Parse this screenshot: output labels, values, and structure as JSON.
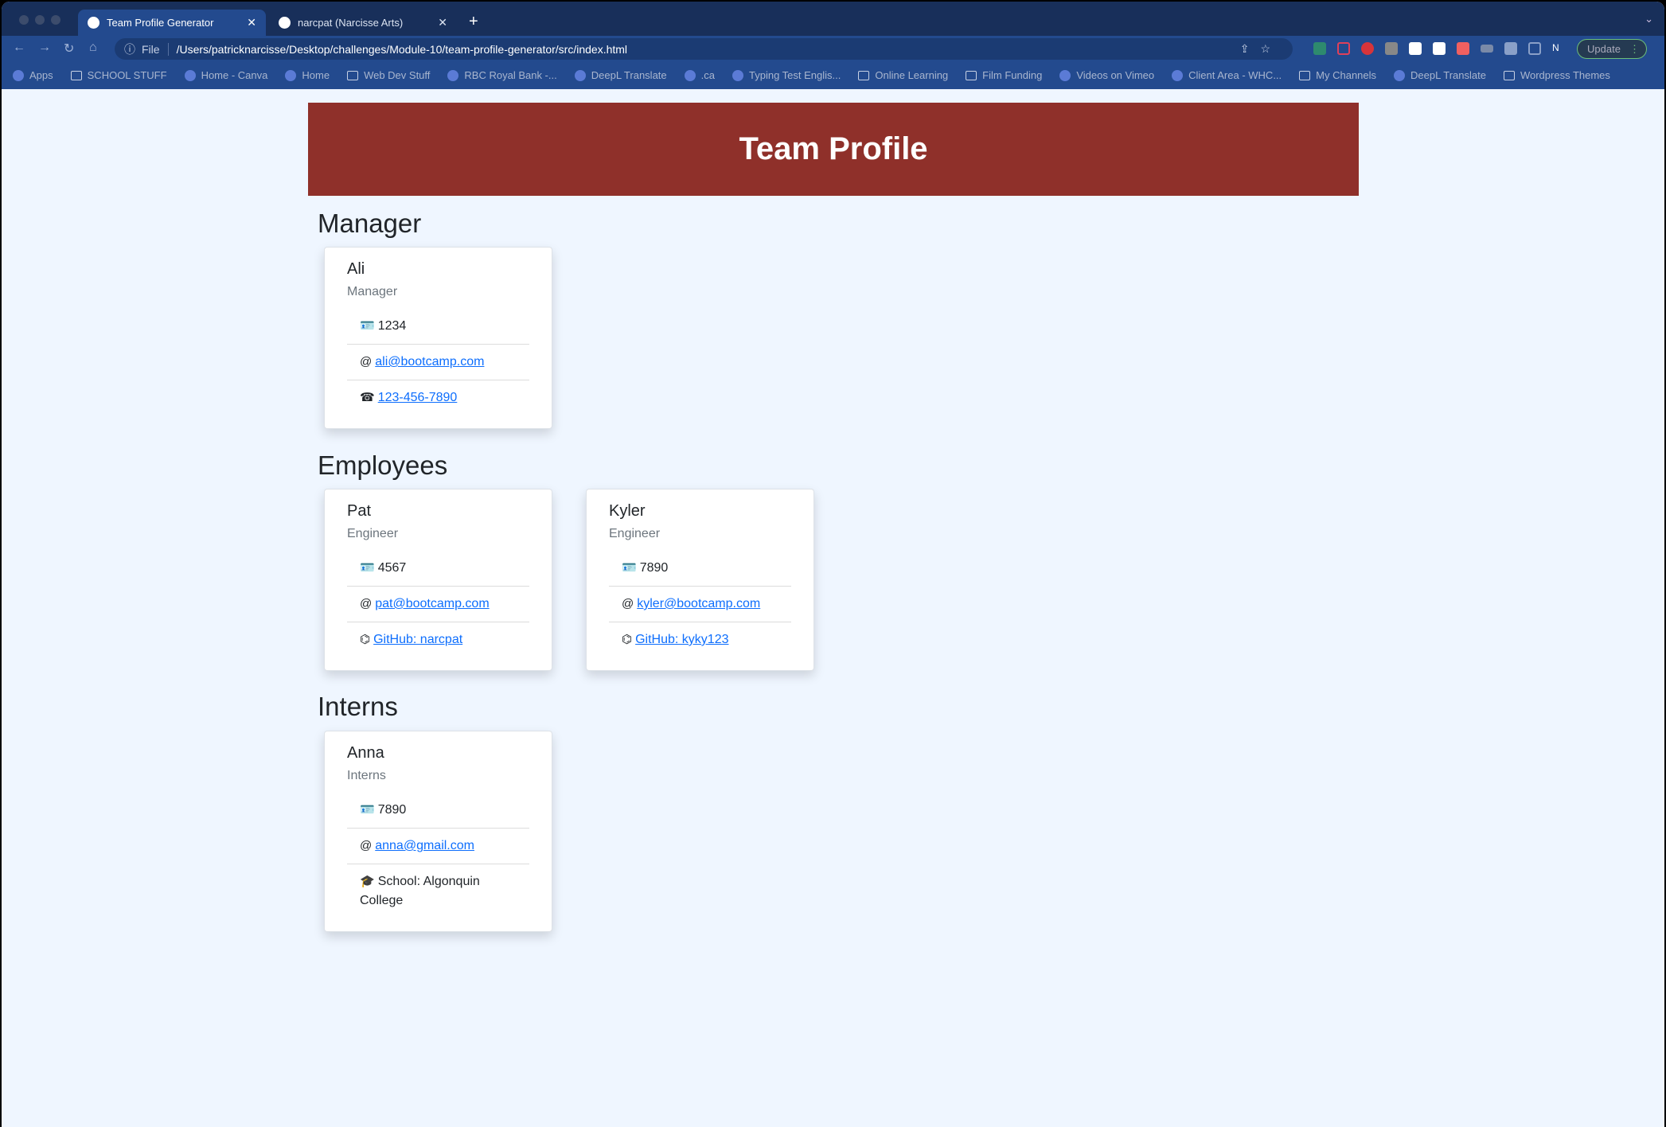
{
  "browser": {
    "tabs": [
      {
        "title": "Team Profile Generator",
        "active": true
      },
      {
        "title": "narcpat (Narcisse Arts)",
        "active": false
      }
    ],
    "address_scheme": "File",
    "url": "/Users/patricknarcisse/Desktop/challenges/Module-10/team-profile-generator/src/index.html",
    "update_label": "Update",
    "profile_initial": "N",
    "bookmarks": [
      "Apps",
      "SCHOOL STUFF",
      "Home - Canva",
      "Home",
      "Web Dev Stuff",
      "RBC Royal Bank -...",
      "DeepL Translate",
      ".ca",
      "Typing Test Englis...",
      "Online Learning",
      "Film Funding",
      "Videos on Vimeo",
      "Client Area - WHC...",
      "My Channels",
      "DeepL Translate",
      "Wordpress Themes"
    ]
  },
  "page": {
    "title": "Team Profile",
    "header_color": "#8f302a",
    "sections": {
      "manager": "Manager",
      "employees": "Employees",
      "interns": "Interns"
    },
    "cards": [
      {
        "name": "Ali",
        "role": "Manager",
        "id": "1234",
        "email": "ali@bootcamp.com",
        "extra": "123-456-7890"
      },
      {
        "name": "Pat",
        "role": "Engineer",
        "id": "4567",
        "email": "pat@bootcamp.com",
        "extra": "GitHub: narcpat"
      },
      {
        "name": "Kyler",
        "role": "Engineer",
        "id": "7890",
        "email": "kyler@bootcamp.com",
        "extra": "GitHub: kyky123"
      },
      {
        "name": "Anna",
        "role": "Interns",
        "id": "7890",
        "email": "anna@gmail.com",
        "extra": "School: Algonquin College"
      }
    ]
  }
}
